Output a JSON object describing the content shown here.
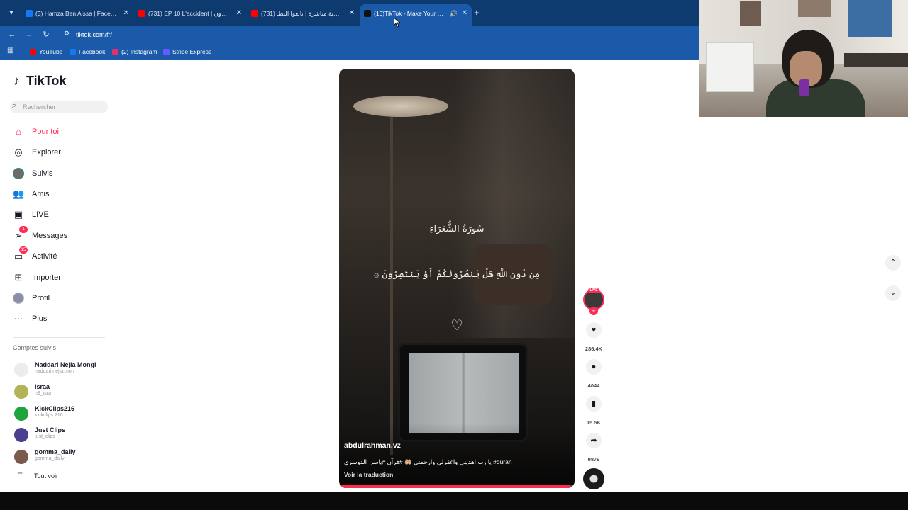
{
  "browser": {
    "tabs": [
      {
        "title": "(3) Hamza Ben Aissa | Facebook",
        "favicon_color": "#1877f2"
      },
      {
        "title": "(731) EP 10 L'accident | سيدون",
        "favicon_color": "#ff0000"
      },
      {
        "title": "(731) تغطية مباشرة | تابعوا التطـ",
        "favicon_color": "#ff0000"
      },
      {
        "title": "(16)TikTok - Make Your Day",
        "favicon_color": "#111111"
      }
    ],
    "active_tab_index": 3,
    "url": "tiktok.com/fr/",
    "bookmarks": [
      {
        "label": "YouTube",
        "color": "#ff0000"
      },
      {
        "label": "Facebook",
        "color": "#1877f2"
      },
      {
        "label": "(2) Instagram",
        "color": "#e1306c"
      },
      {
        "label": "Stripe Express",
        "color": "#635bff"
      }
    ]
  },
  "sidebar": {
    "logo_text": "TikTok",
    "search_placeholder": "Rechercher",
    "nav": [
      {
        "label": "Pour toi",
        "icon": "home-icon"
      },
      {
        "label": "Explorer",
        "icon": "compass-icon"
      },
      {
        "label": "Suivis",
        "icon": "avatar-icon"
      },
      {
        "label": "Amis",
        "icon": "friends-icon"
      },
      {
        "label": "LIVE",
        "icon": "live-icon"
      },
      {
        "label": "Messages",
        "icon": "paper-plane-icon",
        "badge": "1"
      },
      {
        "label": "Activité",
        "icon": "activity-icon",
        "badge": "15"
      },
      {
        "label": "Importer",
        "icon": "upload-icon"
      },
      {
        "label": "Profil",
        "icon": "profile-icon"
      },
      {
        "label": "Plus",
        "icon": "more-icon"
      }
    ],
    "followed_title": "Comptes suivis",
    "followed": [
      {
        "name": "Naddari Nejia Mongi",
        "handle": "naddari.nejia.mon",
        "color": "#ececec"
      },
      {
        "name": "israa",
        "handle": "n9_isra",
        "color": "#b3b35a"
      },
      {
        "name": "KickClips216",
        "handle": "kickclips.216",
        "color": "#1fa33b"
      },
      {
        "name": "Just Clips",
        "handle": "just_clips",
        "color": "#4b3f8f"
      },
      {
        "name": "gomma_daily",
        "handle": "gomma_daily",
        "color": "#7a5a4a"
      }
    ],
    "see_all": "Tout voir"
  },
  "video": {
    "overlay_line1": "سُورَةُ الشُّعَرَاءِ",
    "overlay_line2": "مِن دُونِ اللَّهِ هَلْ يَنصُرُونَكُمْ أَوْ يَنتَصِرُونَ ۞",
    "author": "abdulrahman.vz",
    "description": "يا رب اهديني واغفرلي وارحمني 🤲🏼 #قرآن #ياسر_الدوسري #quran",
    "translate_label": "Voir la traduction",
    "progress": 0.98
  },
  "actions": {
    "live_label": "LIVE",
    "likes": "286.4K",
    "comments": "4044",
    "saves": "15.5K",
    "shares": "9879"
  }
}
